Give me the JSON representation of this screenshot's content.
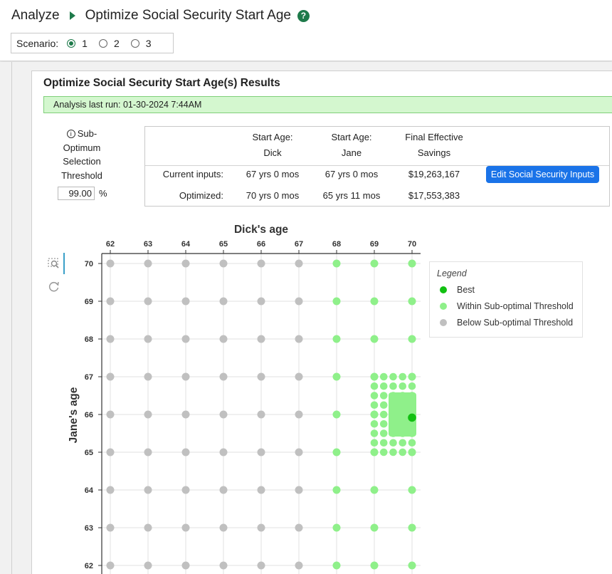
{
  "header": {
    "crumb1": "Analyze",
    "crumb2": "Optimize Social Security Start Age",
    "help_icon": "?"
  },
  "scenario": {
    "label": "Scenario:",
    "options": [
      "1",
      "2",
      "3"
    ],
    "selected": "1"
  },
  "card": {
    "title": "Optimize Social Security Start Age(s) Results",
    "banner": "Analysis last run: 01-30-2024 7:44AM"
  },
  "threshold": {
    "label_lines": [
      "Sub-",
      "Optimum",
      "Selection",
      "Threshold"
    ],
    "value": "99.00",
    "unit": "%"
  },
  "results": {
    "headers": [
      [
        "Start Age:",
        "Dick"
      ],
      [
        "Start Age:",
        "Jane"
      ],
      [
        "Final Effective",
        "Savings"
      ]
    ],
    "rows": [
      {
        "label": "Current inputs:",
        "dick": "67 yrs 0 mos",
        "jane": "67 yrs 0 mos",
        "savings": "$19,263,167"
      },
      {
        "label": "Optimized:",
        "dick": "70 yrs 0 mos",
        "jane": "65 yrs 11 mos",
        "savings": "$17,553,383"
      }
    ],
    "edit_button": "Edit Social Security Inputs"
  },
  "colors": {
    "accent_green": "#1e7a4a",
    "best": "#11c011",
    "within": "#8ff08a",
    "below": "#c0c0c0",
    "button_blue": "#1a73e8"
  },
  "chart_data": {
    "type": "scatter",
    "title": "Dick's age",
    "xlabel": "Dick's age",
    "ylabel": "Jane's age",
    "xlim": [
      62,
      70
    ],
    "ylim": [
      62,
      70
    ],
    "xticks": [
      62,
      63,
      64,
      65,
      66,
      67,
      68,
      69,
      70
    ],
    "yticks": [
      70,
      69,
      68,
      67,
      66,
      65,
      64,
      63,
      62
    ],
    "grid": true,
    "legend": {
      "title": "Legend",
      "placement": "right",
      "entries": [
        "Best",
        "Within Sub-optimal Threshold",
        "Below Sub-optimal Threshold"
      ]
    },
    "grid_points_within": [
      [
        68,
        70
      ],
      [
        69,
        70
      ],
      [
        70,
        70
      ],
      [
        68,
        69
      ],
      [
        69,
        69
      ],
      [
        70,
        69
      ],
      [
        68,
        68
      ],
      [
        69,
        68
      ],
      [
        70,
        68
      ],
      [
        68,
        67
      ],
      [
        69,
        67
      ],
      [
        70,
        67
      ],
      [
        68,
        66
      ],
      [
        69,
        66
      ],
      [
        70,
        66
      ],
      [
        68,
        65
      ],
      [
        69,
        65
      ],
      [
        70,
        65
      ],
      [
        68,
        64
      ],
      [
        69,
        64
      ],
      [
        70,
        64
      ],
      [
        68,
        63
      ],
      [
        69,
        63
      ],
      [
        70,
        63
      ],
      [
        68,
        62
      ],
      [
        69,
        62
      ],
      [
        70,
        62
      ]
    ],
    "monthly_region_within": {
      "x_years": [
        69,
        70
      ],
      "y_years": [
        65,
        67
      ],
      "month_step": 3
    },
    "best_point": [
      70,
      65.9167
    ]
  }
}
